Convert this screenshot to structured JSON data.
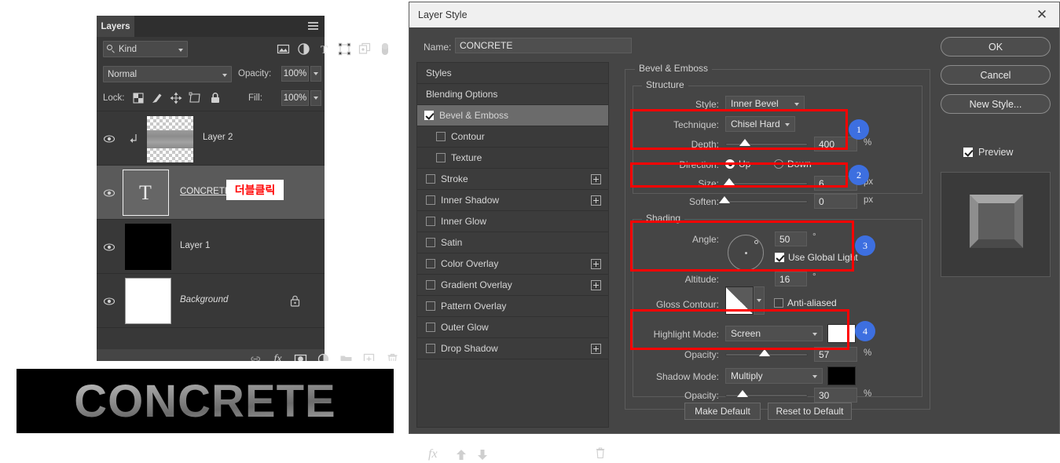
{
  "layers_panel": {
    "tab_label": "Layers",
    "menu_icon": "hamburger-icon",
    "filter": {
      "kind_label": "Kind",
      "search_icon": "search-icon",
      "icons": [
        "image-filter-icon",
        "adjustment-filter-icon",
        "type-filter-icon",
        "shape-filter-icon",
        "smartobject-filter-icon",
        "toggle-filter-icon"
      ]
    },
    "blend_mode": "Normal",
    "opacity_label": "Opacity:",
    "opacity_value": "100%",
    "lock_label": "Lock:",
    "lock_icons": [
      "lock-transparent-icon",
      "lock-image-icon",
      "lock-position-icon",
      "lock-artboard-icon",
      "lock-all-icon"
    ],
    "fill_label": "Fill:",
    "fill_value": "100%",
    "rows": [
      {
        "name": "Layer 2",
        "visible": true,
        "clipped": true,
        "thumb": "checker-gradient",
        "selected": false,
        "italic": false,
        "locked": false
      },
      {
        "name": "CONCRETE",
        "visible": true,
        "clipped": false,
        "thumb": "type-T",
        "selected": true,
        "italic": false,
        "locked": false
      },
      {
        "name": "Layer 1",
        "visible": true,
        "clipped": false,
        "thumb": "black",
        "selected": false,
        "italic": false,
        "locked": false
      },
      {
        "name": "Background",
        "visible": true,
        "clipped": false,
        "thumb": "white",
        "selected": false,
        "italic": true,
        "locked": true
      }
    ],
    "footer_icons": [
      "link-icon",
      "fx-icon",
      "mask-icon",
      "adjustment-icon",
      "folder-icon",
      "new-layer-icon",
      "trash-icon"
    ]
  },
  "annotation": {
    "dblclick_text": "더블클릭",
    "color": "#ff0000"
  },
  "result_image": {
    "text": "CONCRETE"
  },
  "dialog": {
    "title": "Layer Style",
    "close_icon": "close-icon",
    "name_label": "Name:",
    "name_value": "CONCRETE",
    "styles": [
      {
        "label": "Styles",
        "checkbox": false,
        "checked": false,
        "plus": false,
        "active": false,
        "sub": false
      },
      {
        "label": "Blending Options",
        "checkbox": false,
        "checked": false,
        "plus": false,
        "active": false,
        "sub": false
      },
      {
        "label": "Bevel & Emboss",
        "checkbox": true,
        "checked": true,
        "plus": false,
        "active": true,
        "sub": false
      },
      {
        "label": "Contour",
        "checkbox": true,
        "checked": false,
        "plus": false,
        "active": false,
        "sub": true
      },
      {
        "label": "Texture",
        "checkbox": true,
        "checked": false,
        "plus": false,
        "active": false,
        "sub": true
      },
      {
        "label": "Stroke",
        "checkbox": true,
        "checked": false,
        "plus": true,
        "active": false,
        "sub": false
      },
      {
        "label": "Inner Shadow",
        "checkbox": true,
        "checked": false,
        "plus": true,
        "active": false,
        "sub": false
      },
      {
        "label": "Inner Glow",
        "checkbox": true,
        "checked": false,
        "plus": false,
        "active": false,
        "sub": false
      },
      {
        "label": "Satin",
        "checkbox": true,
        "checked": false,
        "plus": false,
        "active": false,
        "sub": false
      },
      {
        "label": "Color Overlay",
        "checkbox": true,
        "checked": false,
        "plus": true,
        "active": false,
        "sub": false
      },
      {
        "label": "Gradient Overlay",
        "checkbox": true,
        "checked": false,
        "plus": true,
        "active": false,
        "sub": false
      },
      {
        "label": "Pattern Overlay",
        "checkbox": true,
        "checked": false,
        "plus": false,
        "active": false,
        "sub": false
      },
      {
        "label": "Outer Glow",
        "checkbox": true,
        "checked": false,
        "plus": false,
        "active": false,
        "sub": false
      },
      {
        "label": "Drop Shadow",
        "checkbox": true,
        "checked": false,
        "plus": true,
        "active": false,
        "sub": false
      }
    ],
    "styles_footer_icons": [
      "fx-icon",
      "move-up-icon",
      "move-down-icon",
      "trash-icon"
    ],
    "section_title": "Bevel & Emboss",
    "structure": {
      "group_label": "Structure",
      "style_label": "Style:",
      "style_value": "Inner Bevel",
      "technique_label": "Technique:",
      "technique_value": "Chisel Hard",
      "depth_label": "Depth:",
      "depth_value": "400",
      "depth_unit": "%",
      "direction_label": "Direction:",
      "direction_up": "Up",
      "direction_down": "Down",
      "direction_selected": "Up",
      "size_label": "Size:",
      "size_value": "6",
      "size_unit": "px",
      "soften_label": "Soften:",
      "soften_value": "0",
      "soften_unit": "px"
    },
    "shading": {
      "group_label": "Shading",
      "angle_label": "Angle:",
      "angle_value": "50",
      "angle_unit": "°",
      "use_global_light": "Use Global Light",
      "use_global_light_checked": true,
      "altitude_label": "Altitude:",
      "altitude_value": "16",
      "altitude_unit": "°",
      "gloss_contour_label": "Gloss Contour:",
      "anti_aliased": "Anti-aliased",
      "anti_aliased_checked": false,
      "highlight_mode_label": "Highlight Mode:",
      "highlight_mode_value": "Screen",
      "highlight_color": "#ffffff",
      "highlight_opacity_label": "Opacity:",
      "highlight_opacity_value": "57",
      "highlight_opacity_unit": "%",
      "shadow_mode_label": "Shadow Mode:",
      "shadow_mode_value": "Multiply",
      "shadow_color": "#000000",
      "shadow_opacity_label": "Opacity:",
      "shadow_opacity_value": "30",
      "shadow_opacity_unit": "%"
    },
    "buttons": {
      "ok": "OK",
      "cancel": "Cancel",
      "new_style": "New Style...",
      "preview": "Preview",
      "preview_checked": true,
      "make_default": "Make Default",
      "reset_to_default": "Reset to Default"
    },
    "callouts": [
      {
        "number": "1"
      },
      {
        "number": "2"
      },
      {
        "number": "3"
      },
      {
        "number": "4"
      }
    ]
  }
}
